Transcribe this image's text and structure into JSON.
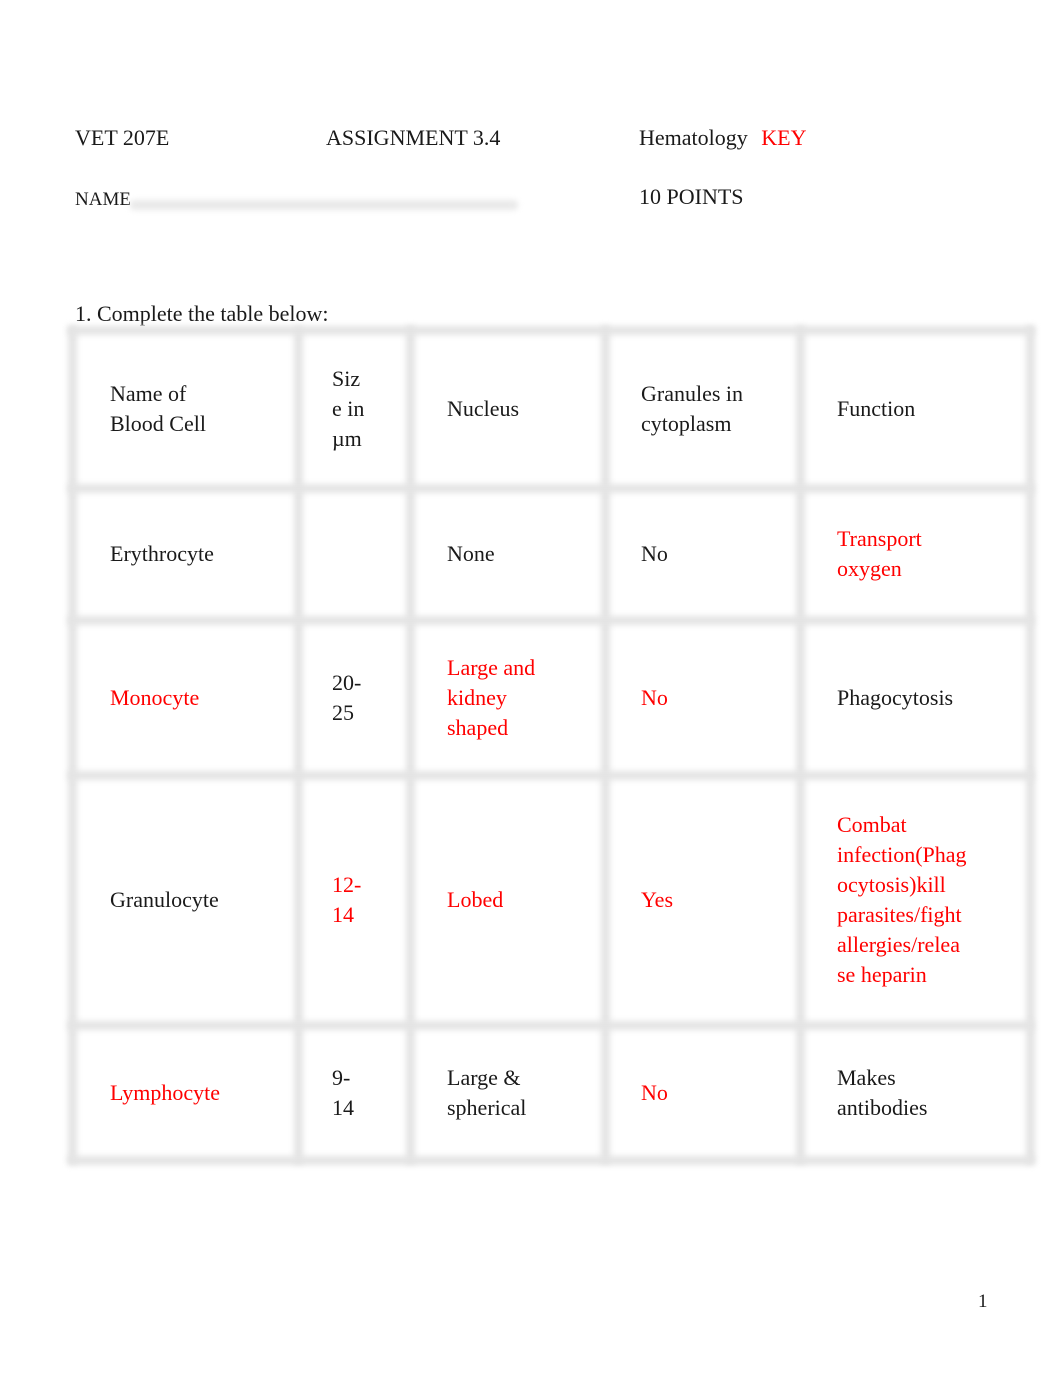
{
  "header": {
    "course": "VET 207E",
    "assignment": "ASSIGNMENT 3.4",
    "subject": "Hematology",
    "key_label": "KEY",
    "name_label": "NAME",
    "points": "10 POINTS"
  },
  "question": "1. Complete the table below:",
  "colors": {
    "answer": "#ff0000",
    "text": "#1a1a1a",
    "grid": "#e4e4e4"
  },
  "table": {
    "headers": [
      {
        "text": "Name of\nBlood Cell",
        "answer": false
      },
      {
        "text": "Siz\ne in\nµm",
        "answer": false
      },
      {
        "text": "Nucleus",
        "answer": false
      },
      {
        "text": "Granules in\ncytoplasm",
        "answer": false
      },
      {
        "text": "Function",
        "answer": false
      }
    ],
    "rows": [
      [
        {
          "text": "Erythrocyte",
          "answer": false
        },
        {
          "text": "",
          "answer": false
        },
        {
          "text": "None",
          "answer": false
        },
        {
          "text": "No",
          "answer": false
        },
        {
          "text": "Transport\noxygen",
          "answer": true
        }
      ],
      [
        {
          "text": "Monocyte",
          "answer": true
        },
        {
          "text": "20-\n25",
          "answer": false
        },
        {
          "text": "Large and\nkidney\nshaped",
          "answer": true
        },
        {
          "text": "No",
          "answer": true
        },
        {
          "text": "Phagocytosis",
          "answer": false
        }
      ],
      [
        {
          "text": "Granulocyte",
          "answer": false
        },
        {
          "text": "12-\n14",
          "answer": true
        },
        {
          "text": "Lobed",
          "answer": true
        },
        {
          "text": "Yes",
          "answer": true
        },
        {
          "text": "Combat\ninfection(Phag\nocytosis)kill\nparasites/fight\nallergies/relea\nse heparin",
          "answer": true
        }
      ],
      [
        {
          "text": "Lymphocyte",
          "answer": true
        },
        {
          "text": "9-\n14",
          "answer": false
        },
        {
          "text": "Large &\nspherical",
          "answer": false
        },
        {
          "text": "No",
          "answer": true
        },
        {
          "text": "Makes\nantibodies",
          "answer": false
        }
      ]
    ]
  },
  "page_number": "1"
}
